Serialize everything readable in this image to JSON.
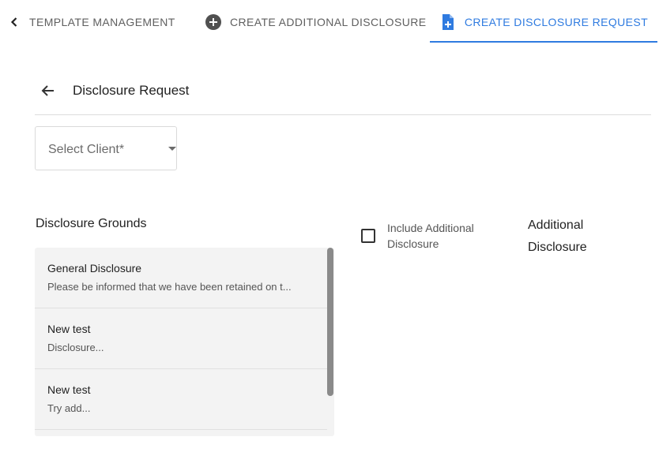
{
  "tabs": {
    "back_label": "TEMPLATE MANAGEMENT",
    "additional_label": "CREATE ADDITIONAL DISCLOSURE",
    "request_label": "CREATE DISCLOSURE REQUEST",
    "active_color": "#2f7be0",
    "icons": [
      "chevron-left-icon",
      "plus-circle-icon",
      "file-plus-icon"
    ]
  },
  "header": {
    "title": "Disclosure Request",
    "back_icon": "arrow-left-icon"
  },
  "client_select": {
    "placeholder": "Select Client*"
  },
  "grounds": {
    "title": "Disclosure Grounds",
    "items": [
      {
        "title": "General Disclosure",
        "subtitle": "Please be informed that we have been retained on t..."
      },
      {
        "title": "New test",
        "subtitle": "Disclosure..."
      },
      {
        "title": "New test",
        "subtitle": "Try add..."
      }
    ]
  },
  "include_additional": {
    "label": "Include Additional Disclosure",
    "checked": false
  },
  "additional_disclosure": {
    "title": "Additional Disclosure"
  }
}
